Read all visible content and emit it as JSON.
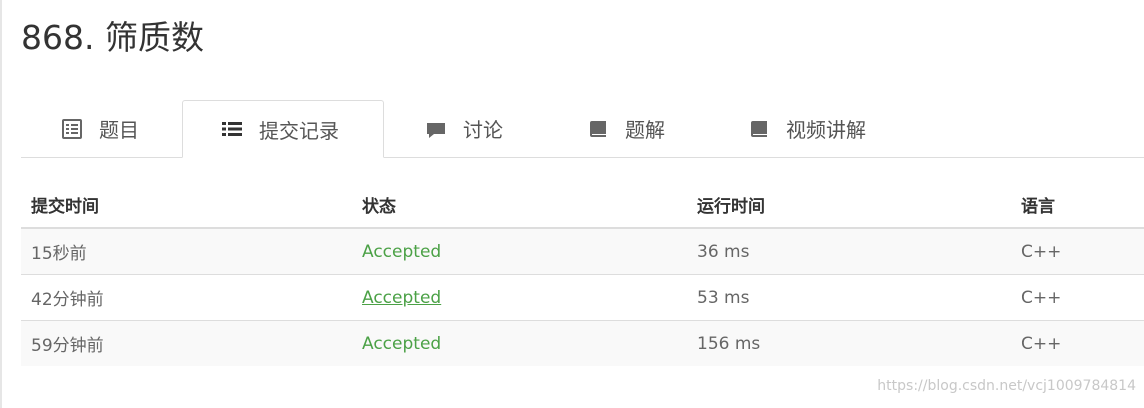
{
  "problem": {
    "title": "868. 筛质数"
  },
  "tabs": [
    {
      "label": "题目",
      "icon": "list-alt-icon",
      "active": false
    },
    {
      "label": "提交记录",
      "icon": "list-icon",
      "active": true
    },
    {
      "label": "讨论",
      "icon": "comment-icon",
      "active": false
    },
    {
      "label": "题解",
      "icon": "book-icon",
      "active": false
    },
    {
      "label": "视频讲解",
      "icon": "book-icon",
      "active": false
    }
  ],
  "submissions": {
    "headers": {
      "time": "提交时间",
      "status": "状态",
      "runtime": "运行时间",
      "language": "语言"
    },
    "rows": [
      {
        "time": "15秒前",
        "status": "Accepted",
        "runtime": "36 ms",
        "language": "C++"
      },
      {
        "time": "42分钟前",
        "status": "Accepted",
        "runtime": "53 ms",
        "language": "C++"
      },
      {
        "time": "59分钟前",
        "status": "Accepted",
        "runtime": "156 ms",
        "language": "C++"
      }
    ]
  },
  "colors": {
    "accepted": "#4ba146",
    "border": "#dddddd",
    "stripe": "#f9f9f9"
  },
  "watermark": "https://blog.csdn.net/vcj1009784814"
}
